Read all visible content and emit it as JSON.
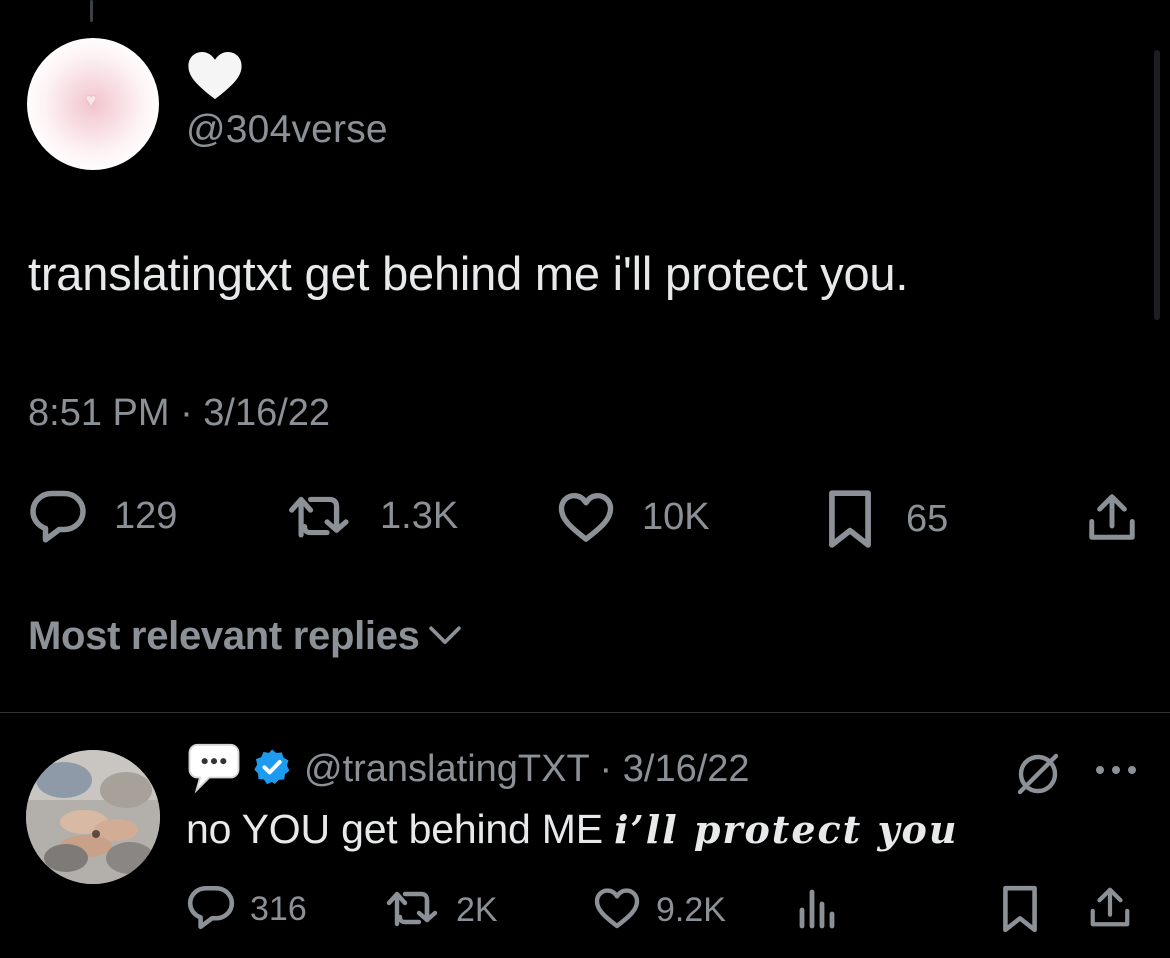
{
  "tweet": {
    "handle": "@304verse",
    "text": "translatingtxt get behind me i'll protect you.",
    "timestamp": "8:51 PM · 3/16/22",
    "stats": {
      "replies": "129",
      "reposts": "1.3K",
      "likes": "10K",
      "bookmarks": "65"
    }
  },
  "replies_filter": {
    "label": "Most relevant replies"
  },
  "reply": {
    "handle_date": "@translatingTXT · 3/16/22",
    "text_plain": "no YOU get behind ME ",
    "text_fancy": "i’ll protect you",
    "stats": {
      "replies": "316",
      "reposts": "2K",
      "likes": "9.2K"
    }
  },
  "colors": {
    "background": "#000000",
    "text": "#e7e9ea",
    "muted": "#8b9197",
    "verified": "#1d9bf0"
  },
  "icons": [
    "heart-icon",
    "reply-icon",
    "repost-icon",
    "like-icon",
    "bookmark-icon",
    "share-icon",
    "speech-bubble-icon",
    "verified-badge-icon",
    "grok-icon",
    "more-icon",
    "views-icon",
    "chevron-down-icon"
  ]
}
